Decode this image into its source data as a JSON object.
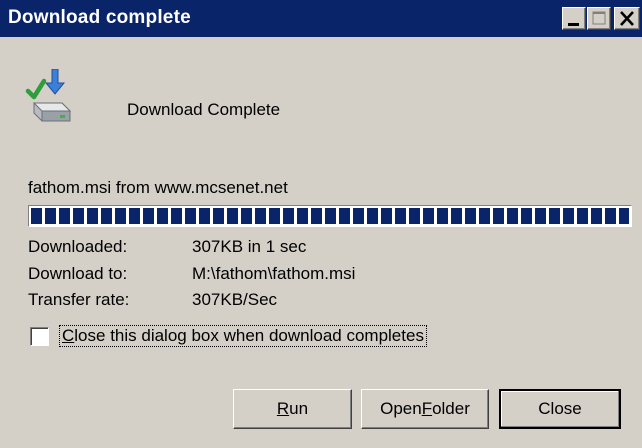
{
  "window": {
    "title": "Download complete",
    "controls": {
      "minimize": "minimize",
      "maximize": "maximize",
      "close": "close"
    }
  },
  "header": {
    "icon": "download-complete-icon",
    "text": "Download Complete"
  },
  "source": "fathom.msi from www.mcsenet.net",
  "progress": {
    "percent": 100
  },
  "info": [
    {
      "label": "Downloaded:",
      "value": "307KB in 1 sec"
    },
    {
      "label": "Download to:",
      "value": "M:\\fathom\\fathom.msi"
    },
    {
      "label": "Transfer rate:",
      "value": "307KB/Sec"
    }
  ],
  "close_on_complete": {
    "label": "Close this dialog box when download completes",
    "checked": false
  },
  "buttons": {
    "run": "Run",
    "open_folder": "Open Folder",
    "close": "Close"
  },
  "colors": {
    "titlebar": "#0a246a",
    "face": "#d4d0c8",
    "progress": "#0a246a"
  }
}
